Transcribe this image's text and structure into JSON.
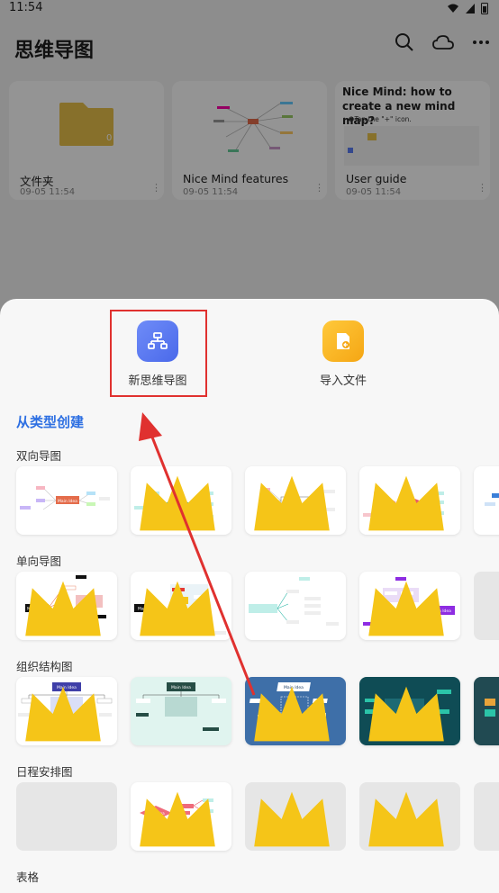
{
  "status_bar": {
    "time": "11:54"
  },
  "app": {
    "title": "思维导图"
  },
  "cards": [
    {
      "title": "文件夹",
      "date": "09-05 11:54",
      "folder_badge": "0"
    },
    {
      "title": "Nice Mind features",
      "date": "09-05 11:54"
    },
    {
      "title": "User guide",
      "date": "09-05 11:54",
      "preview_title": "Nice Mind: how to create a new mind map?",
      "preview_step": "• ❶Tap the \"+\" icon."
    }
  ],
  "sheet": {
    "actions": [
      {
        "label": "新思维导图",
        "icon": "mindmap-icon",
        "color": "#5b7cf3"
      },
      {
        "label": "导入文件",
        "icon": "import-icon",
        "color": "#f7b21c"
      }
    ],
    "section_title": "从类型创建",
    "categories": [
      {
        "name": "双向导图"
      },
      {
        "name": "单向导图"
      },
      {
        "name": "组织结构图"
      },
      {
        "name": "日程安排图"
      },
      {
        "name": "表格"
      }
    ],
    "template_texts": {
      "main_idea": "Main Idea",
      "topic": "Topic",
      "summary": "Summary"
    }
  },
  "colors": {
    "accent": "#2d6fe2",
    "annotation": "#e0312f",
    "crown": "#f5c518"
  }
}
